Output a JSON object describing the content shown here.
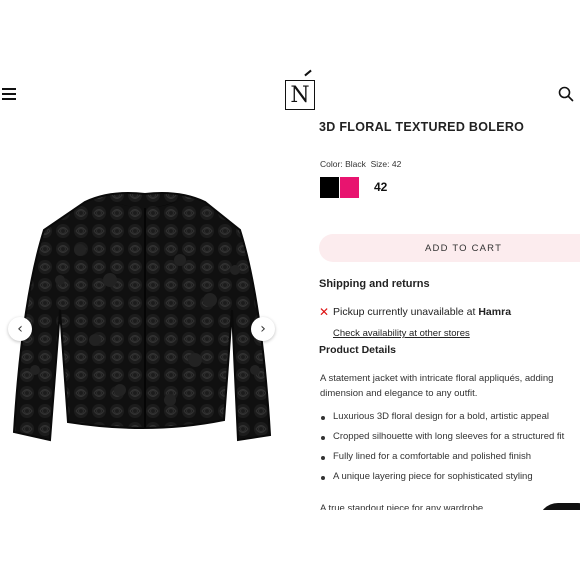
{
  "header": {
    "menu_icon": "hamburger-menu-icon",
    "logo_letter": "N",
    "search_icon": "search-icon"
  },
  "gallery": {
    "prev_glyph": "‹",
    "next_glyph": "›"
  },
  "product": {
    "title": "3D FLORAL TEXTURED BOLERO",
    "color_label": "Color:",
    "color_value": "Black",
    "size_label": "Size:",
    "size_value": "42",
    "swatches": [
      {
        "name": "Black",
        "hex": "#000000"
      },
      {
        "name": "Pink",
        "hex": "#e8146f"
      }
    ],
    "size_option": "42"
  },
  "cart": {
    "add_label": "ADD TO CART"
  },
  "shipping": {
    "heading": "Shipping and returns",
    "pickup_prefix": "Pickup currently unavailable at ",
    "pickup_store": "Hamra",
    "check_link": "Check availability at other stores"
  },
  "details": {
    "heading": "Product Details",
    "description": "A statement jacket with intricate floral appliqués, adding dimension and elegance to any outfit.",
    "bullets": [
      "Luxurious 3D floral design for a bold, artistic appeal",
      "Cropped silhouette with long sleeves for a structured fit",
      "Fully lined for a comfortable and polished finish",
      "A unique layering piece for sophisticated styling"
    ],
    "tagline": "A true standout piece for any wardrobe."
  },
  "colors": {
    "accent_pink": "#fcecee",
    "swatch_pink": "#e8146f",
    "unavailable_red": "#dd1111"
  }
}
